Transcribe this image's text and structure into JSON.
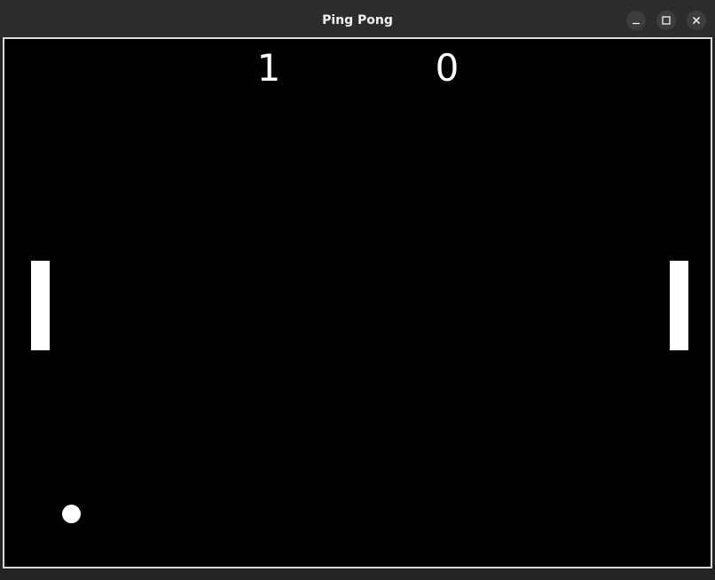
{
  "window": {
    "title": "Ping Pong",
    "controls": [
      "minimize-icon",
      "maximize-icon",
      "close-icon"
    ]
  },
  "game": {
    "score_left": "1",
    "score_right": "0",
    "colors": {
      "background": "#000000",
      "foreground": "#ffffff"
    }
  }
}
